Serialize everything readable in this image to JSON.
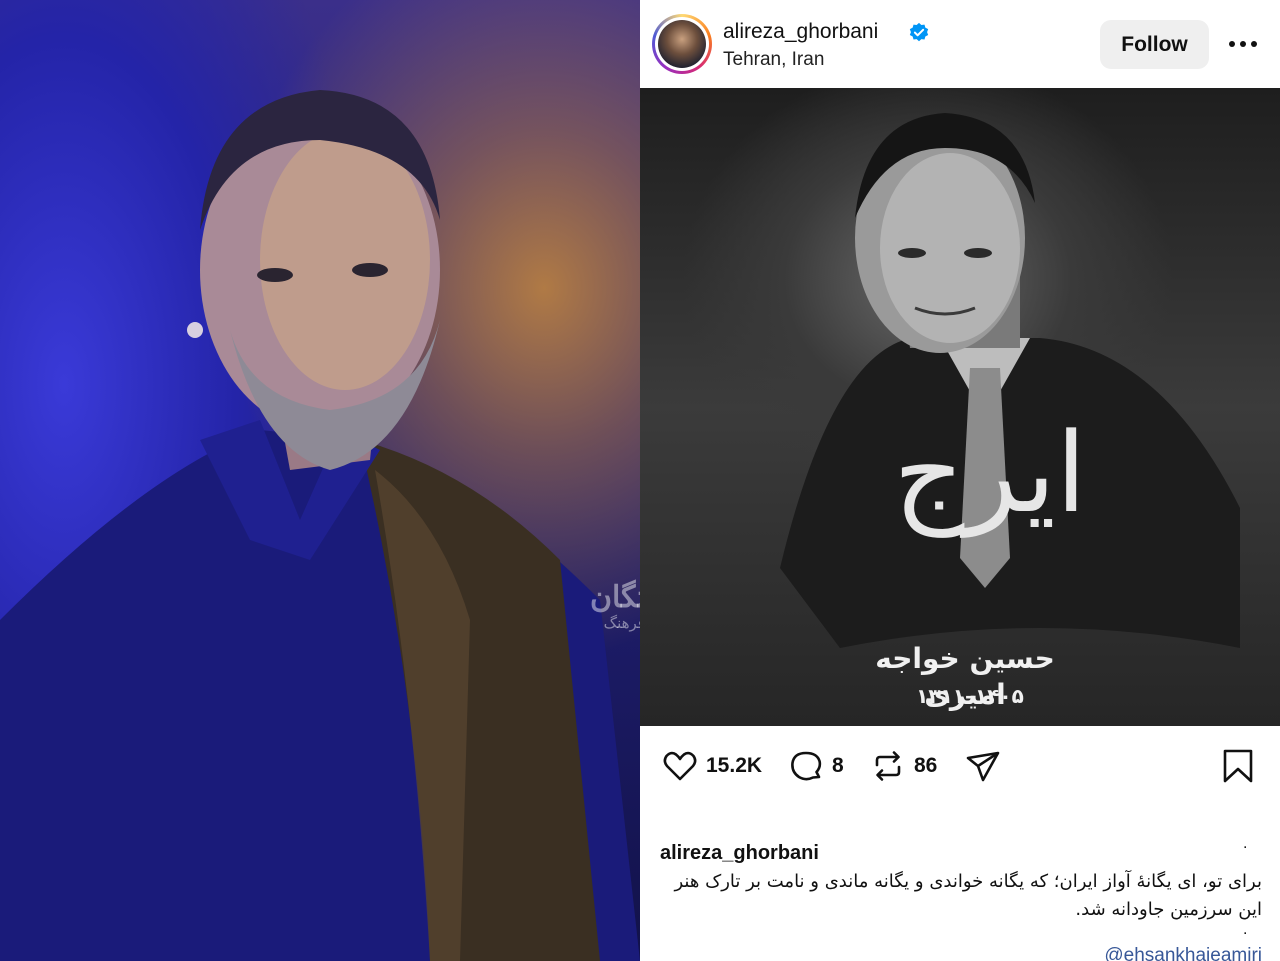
{
  "left_photo": {
    "watermark_main": "فرهیختگان",
    "watermark_sub": "چارسوفرهنگ"
  },
  "post": {
    "username": "alireza_ghorbani",
    "location": "Tehran, Iran",
    "follow_label": "Follow",
    "image": {
      "title": "ایرج",
      "subtitle": "حسین خواجه امیری",
      "dates": "۱۳۱۱–۱۴۰۵"
    },
    "actions": {
      "likes": "15.2K",
      "comments": "8",
      "reposts": "86"
    },
    "caption": {
      "username": "alireza_ghorbani",
      "dot": ".",
      "text": "برای تو، ای یگانهٔ آواز ایران؛ که یگانه خواندی و یگانه ماندی و نامت بر تارک هنر این سرزمین جاودانه شد.",
      "mention": "@ehsankhajeamiri"
    }
  },
  "colors": {
    "verified": "#0095f6",
    "mention": "#385898",
    "follow_bg": "#efefef"
  },
  "icons": [
    "verified-badge-icon",
    "more-options-icon",
    "heart-icon",
    "comment-icon",
    "repost-icon",
    "share-icon",
    "bookmark-icon"
  ]
}
